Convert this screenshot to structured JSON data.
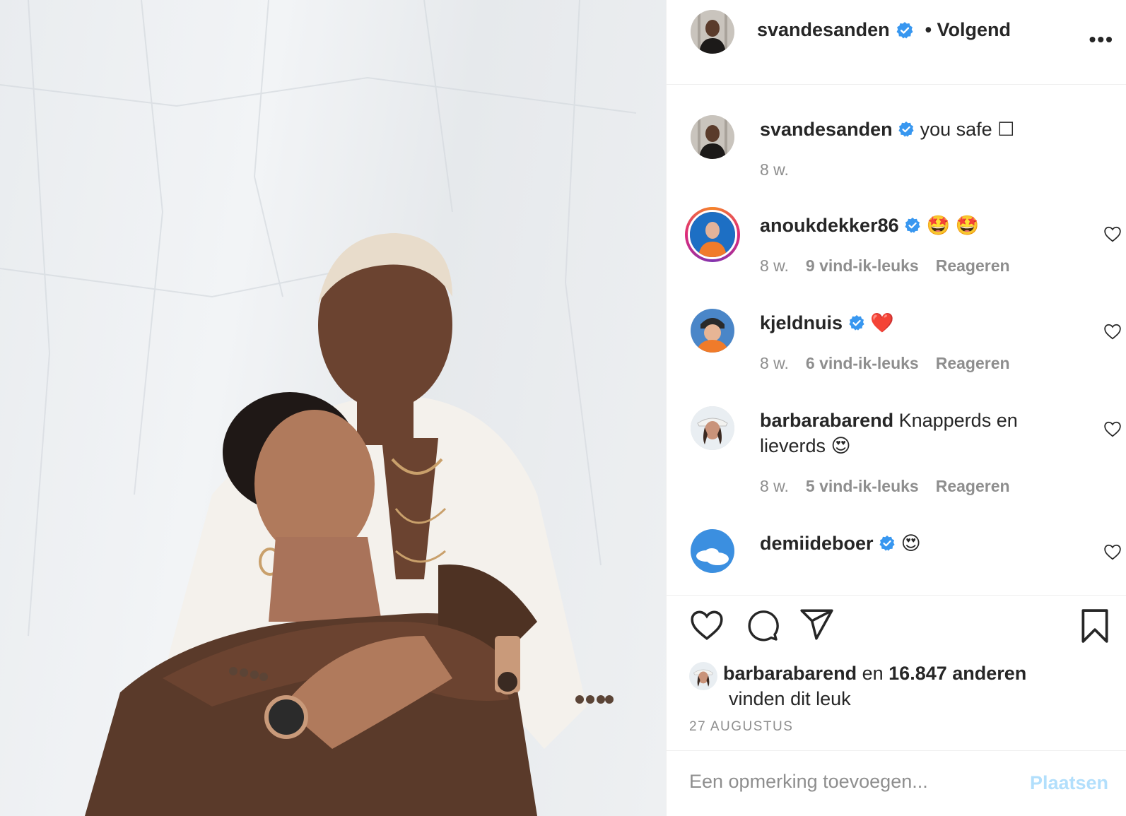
{
  "post": {
    "author": "svandesanden",
    "follow_status": "• Volgend",
    "more_label": "•••",
    "caption_user": "svandesanden",
    "caption_text": "you safe ☐",
    "caption_time": "8 w."
  },
  "comments": [
    {
      "user": "anoukdekker86",
      "text": "🤩 🤩",
      "time": "8 w.",
      "likes": "9 vind-ik-leuks",
      "reply": "Reageren",
      "verified": true
    },
    {
      "user": "kjeldnuis",
      "text": "❤️",
      "time": "8 w.",
      "likes": "6 vind-ik-leuks",
      "reply": "Reageren",
      "verified": true
    },
    {
      "user": "barbarabarend",
      "text": "Knapperds en lieverds 😍",
      "time": "8 w.",
      "likes": "5 vind-ik-leuks",
      "reply": "Reageren",
      "verified": false
    },
    {
      "user": "demiideboer",
      "text": "😍",
      "verified": true
    }
  ],
  "likes_summary": {
    "user": "barbarabarend",
    "connector": "en",
    "others": "16.847 anderen",
    "suffix": "vinden dit leuk"
  },
  "date": "27 AUGUSTUS",
  "add_comment": {
    "placeholder": "Een opmerking toevoegen...",
    "post_label": "Plaatsen"
  },
  "colors": {
    "verified_blue": "#3897f0",
    "muted": "#8e8e8e",
    "post_disabled": "#b2dffc"
  }
}
